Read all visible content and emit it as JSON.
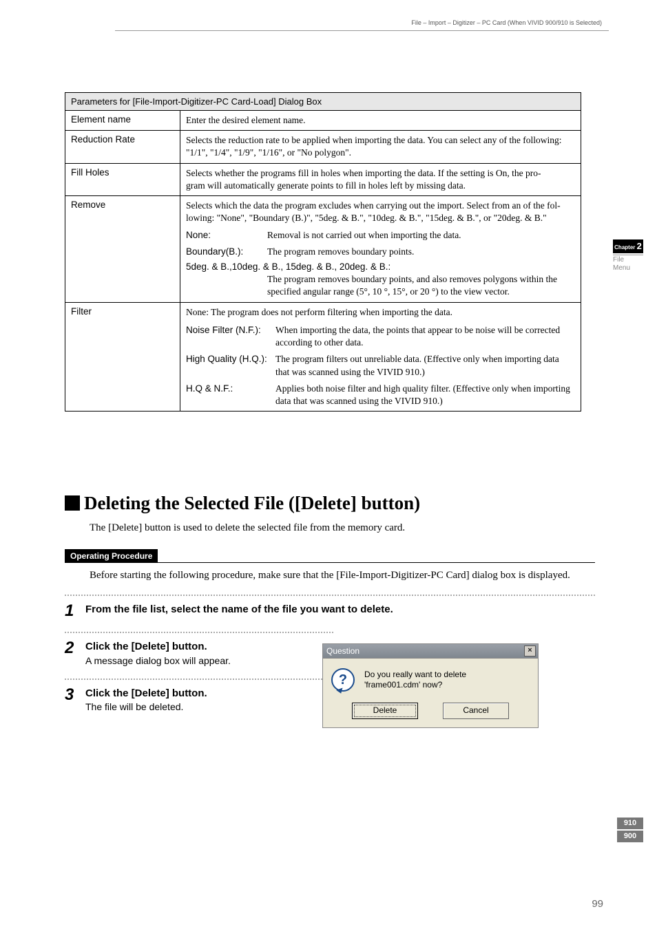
{
  "breadcrumb": "File – Import – Digitizer – PC Card (When VIVID 900/910 is Selected)",
  "table": {
    "title": "Parameters for [File-Import-Digitizer-PC Card-Load] Dialog Box",
    "rows": [
      {
        "name": "Element name",
        "desc": "Enter the desired element name."
      },
      {
        "name": "Reduction Rate",
        "desc_a": "Selects the reduction rate to be applied when importing the data. You can select any of the following:",
        "desc_b": "\"1/1\", \"1/4\", \"1/9\", \"1/16\", or \"No polygon\"."
      },
      {
        "name": "Fill Holes",
        "desc_a": "Selects whether the programs fill in holes when importing the data. If the setting is On, the pro-",
        "desc_b": "gram will automatically generate points to fill in holes left by missing data."
      },
      {
        "name": "Remove",
        "desc_a": "Selects which the data the program excludes when carrying out the import. Select from an of the fol-",
        "desc_b": "lowing: \"None\", \"Boundary (B.)\", \"5deg. & B.\", \"10deg. & B.\", \"15deg. & B.\", or \"20deg. & B.\"",
        "opts": [
          {
            "k": "None:",
            "v": "Removal is not carried out when importing the data."
          },
          {
            "k": "Boundary(B.):",
            "v": "The program removes boundary points."
          },
          {
            "k": "5deg. & B.,10deg. & B., 15deg. & B., 20deg. & B.:",
            "v1": "The program removes boundary points, and also removes polygons within the",
            "v2": "specified angular range (5°, 10 °, 15°, or 20 °) to the view vector."
          }
        ]
      },
      {
        "name": "Filter",
        "desc_a": "None: The program does not perform filtering when importing the data.",
        "opts": [
          {
            "k": "Noise Filter (N.F.):",
            "v": "When importing the data, the points that appear to be noise will be corrected",
            "v2": "according to other data."
          },
          {
            "k": "High Quality (H.Q.):",
            "v": "The program filters out unreliable data. (Effective only when importing data",
            "v2": "that was scanned using the VIVID 910.)"
          },
          {
            "k": "H.Q & N.F.:",
            "v": "Applies both noise filter and high quality filter. (Effective only when importing",
            "v2": "data that was scanned using the VIVID 910.)"
          }
        ]
      }
    ]
  },
  "side": {
    "chapter": "2",
    "sub1": "File",
    "sub2": "Menu",
    "model1": "910",
    "model2": "900"
  },
  "section": {
    "heading": "Deleting the Selected File ([Delete] button)",
    "intro": "The [Delete] button is used to delete the selected file from the memory card.",
    "op_label": "Operating Procedure",
    "before": "Before starting the following procedure, make sure that the [File-Import-Digitizer-PC Card] dialog box is displayed.",
    "steps": [
      {
        "n": "1",
        "t": "From the file list, select the name of the file you want to delete."
      },
      {
        "n": "2",
        "t": "Click the [Delete] button.",
        "s": "A message dialog box will appear."
      },
      {
        "n": "3",
        "t": "Click the [Delete] button.",
        "s": "The file will be deleted."
      }
    ]
  },
  "dialog": {
    "title": "Question",
    "msg1": "Do you really want to delete",
    "msg2": "'frame001.cdm' now?",
    "btn_delete": "Delete",
    "btn_cancel": "Cancel"
  },
  "page_number": "99"
}
